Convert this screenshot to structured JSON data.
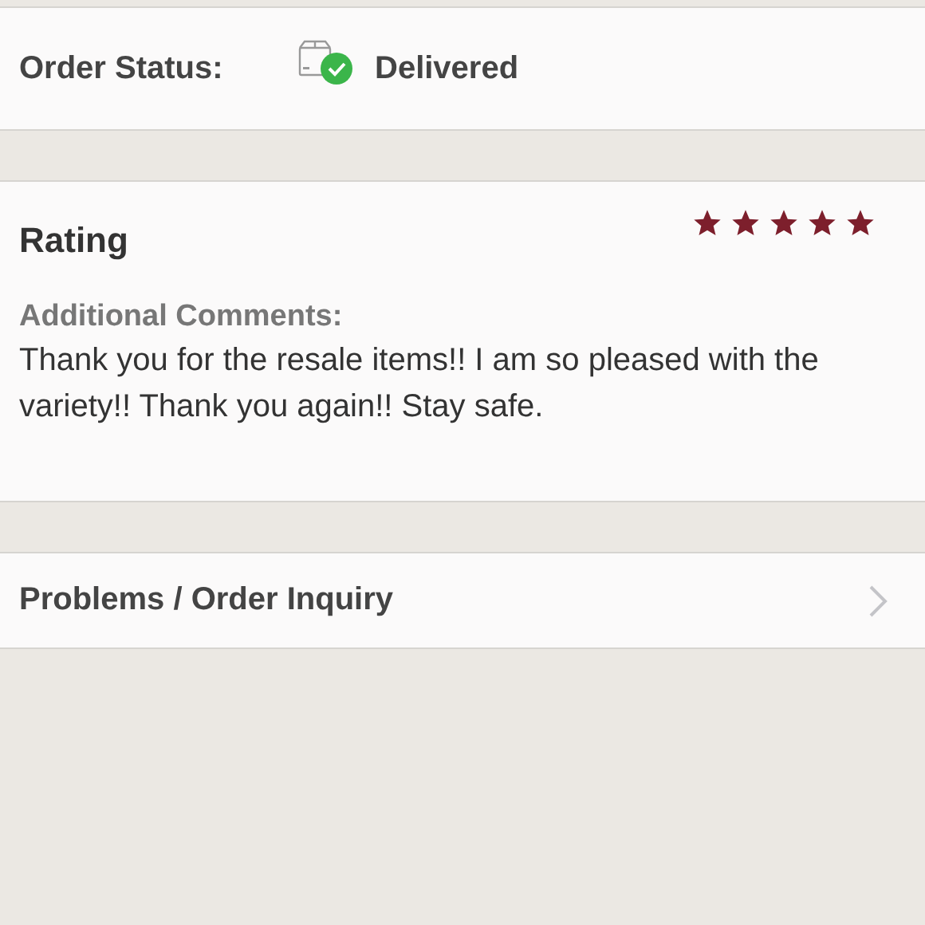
{
  "order_status": {
    "label": "Order Status:",
    "kind": "delivered",
    "value": "Delivered"
  },
  "rating": {
    "title": "Rating",
    "stars": 5,
    "comments_label": "Additional Comments:",
    "comments": "Thank you for the resale items!! I am so pleased with the variety!! Thank you again!! Stay safe."
  },
  "inquiry": {
    "label": "Problems / Order Inquiry"
  }
}
